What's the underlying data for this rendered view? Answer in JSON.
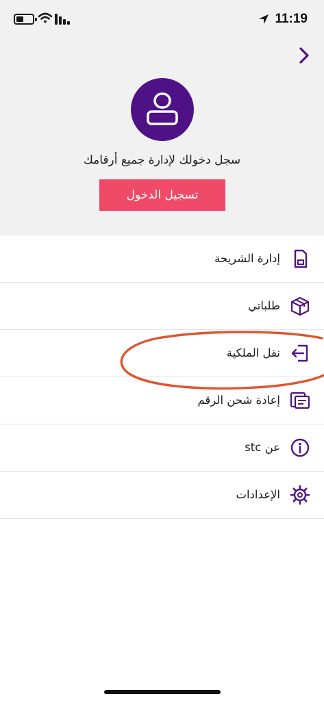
{
  "status_bar": {
    "time": "11:19"
  },
  "profile": {
    "prompt": "سجل دخولك لإدارة جميع أرقامك",
    "login_label": "تسجيل الدخول"
  },
  "menu": {
    "items": [
      {
        "label": "إدارة الشريحة",
        "icon": "sim-card-icon"
      },
      {
        "label": "طلباتي",
        "icon": "package-box-icon"
      },
      {
        "label": "نقل الملكية",
        "icon": "transfer-ownership-icon"
      },
      {
        "label": "إعادة شحن الرقم",
        "icon": "recharge-card-icon"
      },
      {
        "label": "عن stc",
        "icon": "info-icon"
      },
      {
        "label": "الإعدادات",
        "icon": "settings-gear-icon"
      }
    ]
  },
  "colors": {
    "brand_purple": "#4f1286",
    "login_button": "#ef4b68",
    "header_background": "#f1f1f1",
    "annotation_ellipse": "#e0552e"
  }
}
